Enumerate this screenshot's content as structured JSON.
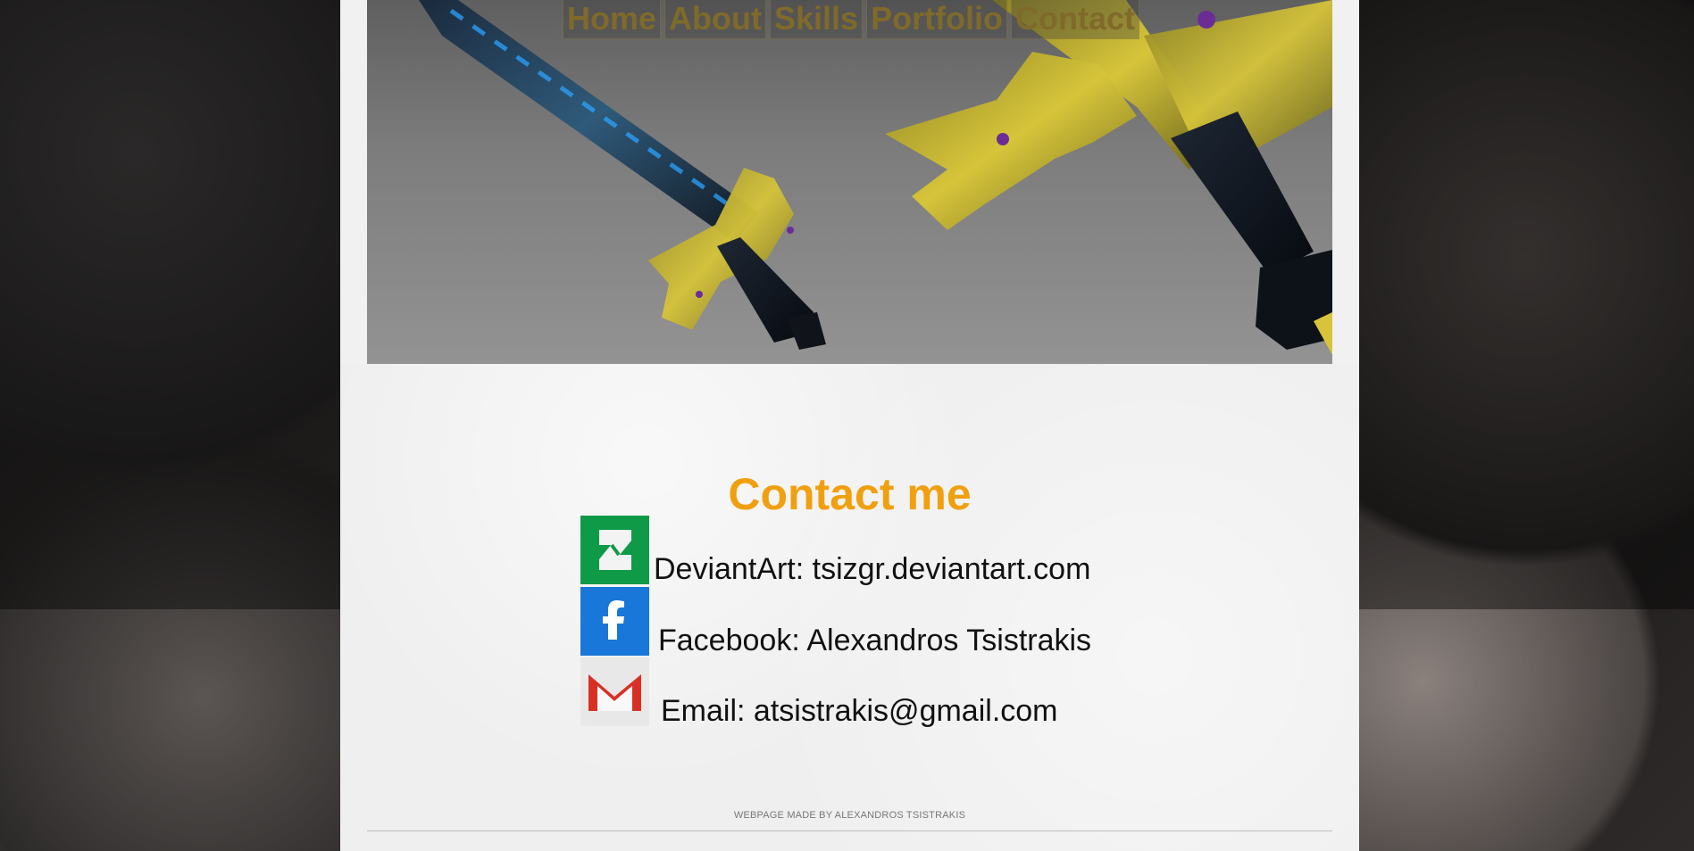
{
  "nav": {
    "items": [
      "Home",
      "About",
      "Skills",
      "Portfolio",
      "Contact"
    ]
  },
  "contact": {
    "title": "Contact me",
    "deviantart": {
      "label": "DeviantArt: tsizgr.deviantart.com",
      "icon": "deviantart-icon",
      "color": "#0f9a47"
    },
    "facebook": {
      "label": "Facebook: Alexandros Tsistrakis",
      "icon": "facebook-icon",
      "color": "#1877d8"
    },
    "email": {
      "label": "Email:  atsistrakis@gmail.com",
      "icon": "gmail-icon",
      "color": "#d93025"
    }
  },
  "footer": {
    "credit": "WEBPAGE MADE BY ALEXANDROS TSISTRAKIS"
  },
  "colors": {
    "title": "#f0a00f",
    "text": "#111111",
    "page_bg": "#f1f1f1"
  }
}
